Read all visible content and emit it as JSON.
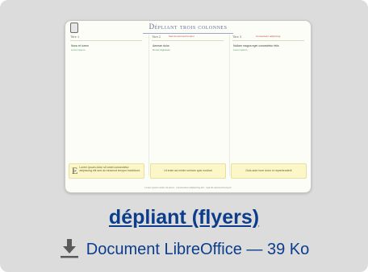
{
  "thumbnail": {
    "title": "Dépliant trois colonnes",
    "columns": [
      {
        "head": "Titre 1",
        "side": "",
        "item": "Nunc et lorem",
        "sub": "Lorem ipsum"
      },
      {
        "head": "Titre 2",
        "side": "Sed do eiusmod tempor",
        "item": "Aenean dolor",
        "sub": "Donec dignissim"
      },
      {
        "head": "Titre 3",
        "side": "Consectetur adipiscing",
        "item": "Nullam magna eget consectetur felis",
        "sub": "Lorem ipsum"
      }
    ],
    "notes": [
      {
        "letter": "E",
        "text": "Lorem ipsum dolor sit amet consectetur adipiscing elit sed do eiusmod tempor incididunt."
      },
      {
        "letter": "",
        "text": "Ut enim ad minim veniam quis nostrud"
      },
      {
        "letter": "",
        "text": "Duis aute irure dolor in reprehenderit"
      }
    ],
    "footer": "Lorem ipsum dolor sit amet · consectetur adipiscing elit · sed do eiusmod tempor"
  },
  "file": {
    "name": "dépliant (flyers)",
    "type_size": "Document LibreOffice — 39 Ko",
    "icon": "download-icon"
  },
  "colors": {
    "card_bg": "#dcdcdc",
    "link": "#0b3d8c"
  }
}
